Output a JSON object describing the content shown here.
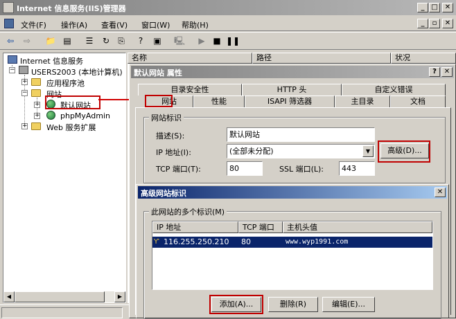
{
  "window": {
    "title": "Internet 信息服务(IIS)管理器"
  },
  "menu": [
    "文件(F)",
    "操作(A)",
    "查看(V)",
    "窗口(W)",
    "帮助(H)"
  ],
  "tree": {
    "root": "Internet 信息服务",
    "computer": "USERS2003 (本地计算机)",
    "app_pools": "应用程序池",
    "websites": "网站",
    "default_site": "默认网站",
    "phpmyadmin": "phpMyAdmin",
    "web_ext": "Web 服务扩展"
  },
  "list_columns": [
    "名称",
    "路径",
    "状况"
  ],
  "props": {
    "title": "默认网站 属性",
    "tabs_row1": [
      "目录安全性",
      "HTTP 头",
      "自定义错误"
    ],
    "tabs_row2": [
      "网站",
      "性能",
      "ISAPI 筛选器",
      "主目录",
      "文档"
    ],
    "group": "网站标识",
    "desc_label": "描述(S):",
    "desc_value": "默认网站",
    "ip_label": "IP 地址(I):",
    "ip_value": "(全部未分配)",
    "advanced_btn": "高级(D)...",
    "tcp_label": "TCP 端口(T):",
    "tcp_value": "80",
    "ssl_label": "SSL 端口(L):",
    "ssl_value": "443"
  },
  "adv": {
    "title": "高级网站标识",
    "group": "此网站的多个标识(M)",
    "columns": [
      "IP 地址",
      "TCP 端口",
      "主机头值"
    ],
    "rows": [
      {
        "ip": "116.255.250.210",
        "port": "80",
        "host": "www.wyp1991.com"
      }
    ],
    "add_btn": "添加(A)...",
    "delete_btn": "删除(R)",
    "edit_btn": "编辑(E)..."
  }
}
